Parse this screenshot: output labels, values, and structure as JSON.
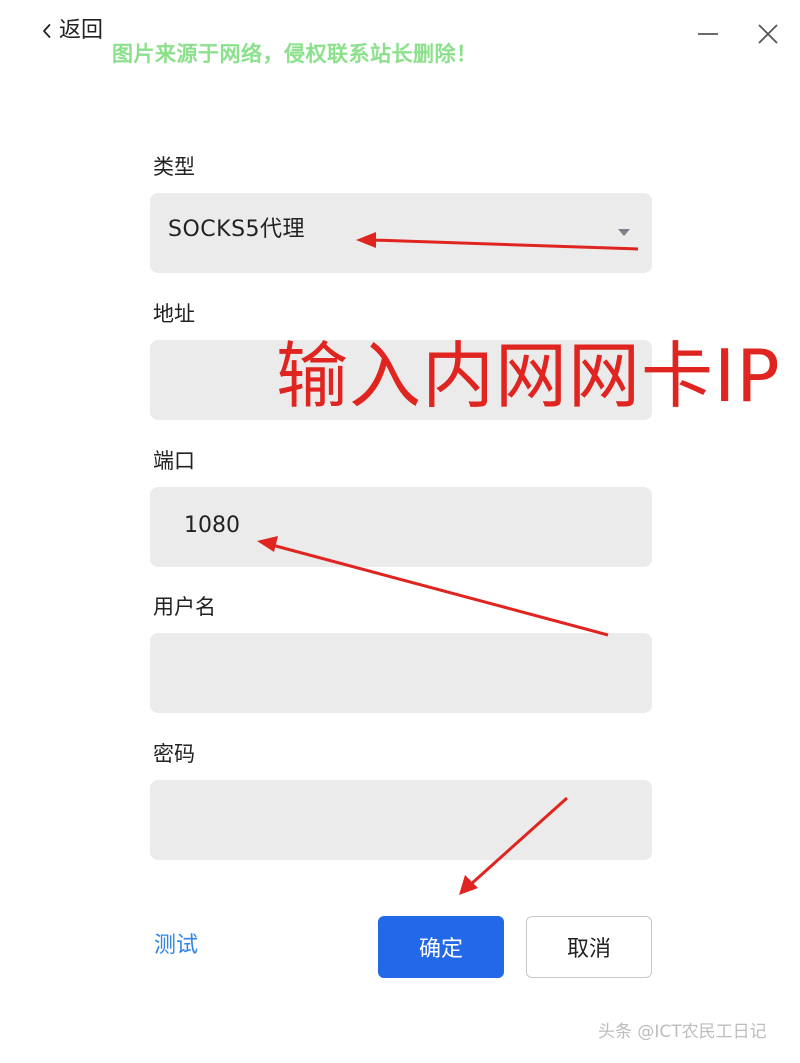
{
  "header": {
    "back_label": "返回",
    "back_icon": "chevron-left-icon",
    "minimize_icon": "minimize-icon",
    "close_icon": "close-icon"
  },
  "watermark_top": "图片来源于网络，侵权联系站长删除！",
  "form": {
    "type": {
      "label": "类型",
      "value": "SOCKS5代理",
      "dropdown_icon": "caret-down-icon"
    },
    "address": {
      "label": "地址",
      "value": ""
    },
    "port": {
      "label": "端口",
      "value": "1080"
    },
    "username": {
      "label": "用户名",
      "value": ""
    },
    "password": {
      "label": "密码",
      "value": ""
    }
  },
  "footer": {
    "test_label": "测试",
    "confirm_label": "确定",
    "cancel_label": "取消"
  },
  "annotation": {
    "text": "输入内网网卡IP",
    "color": "#e02420"
  },
  "watermark_bottom": "头条 @ICT农民工日记",
  "colors": {
    "accent": "#2368e8",
    "link": "#2f84e6",
    "field_bg": "#ebebeb",
    "watermark": "#8be08b"
  }
}
